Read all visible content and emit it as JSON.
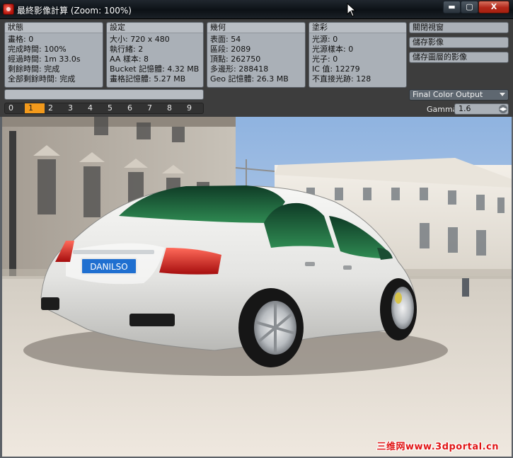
{
  "window": {
    "title": "最終影像計算 (Zoom: 100%)",
    "min_glyph": "▬",
    "max_glyph": "▢",
    "close_glyph": "X"
  },
  "groups": {
    "status": {
      "header": "狀態",
      "lines": [
        "畫格: 0",
        "完成時間: 100%",
        "經過時間: 1m 33.0s",
        "剩餘時間: 完成",
        "全部剩餘時間: 完成"
      ]
    },
    "settings": {
      "header": "設定",
      "lines": [
        "大小: 720 x 480",
        "執行緒: 2",
        "AA 樣本: 8",
        "Bucket 記憶體: 4.32 MB",
        "畫格記憶體: 5.27 MB"
      ]
    },
    "geometry": {
      "header": "幾何",
      "lines": [
        "表面: 54",
        "區段: 2089",
        "頂點: 262750",
        "多邊形: 288418",
        "Geo 記憶體: 26.3 MB"
      ]
    },
    "shading": {
      "header": "塗彩",
      "lines": [
        "光源: 0",
        "光源樣本: 0",
        "光子: 0",
        "IC 值: 12279",
        "不直接光跡: 128"
      ]
    }
  },
  "buttons": {
    "close_view": "關閉視窗",
    "save_image": "儲存影像",
    "save_layers": "儲存圖層的影像"
  },
  "progress": {
    "fraction": 1.0
  },
  "layers": {
    "tabs": [
      "0",
      "1",
      "2",
      "3",
      "4",
      "5",
      "6",
      "7",
      "8",
      "9"
    ],
    "active_index": 1
  },
  "output": {
    "selected": "Final Color Output"
  },
  "gamma": {
    "label": "Gamma",
    "value": "1.6"
  },
  "render": {
    "plate_text": "DANILSO"
  },
  "watermark": {
    "text": "三维网www.3dportal.cn"
  },
  "colors": {
    "active_tab": "#f39a1c",
    "close_button": "#b3281a",
    "watermark": "#e01515"
  }
}
